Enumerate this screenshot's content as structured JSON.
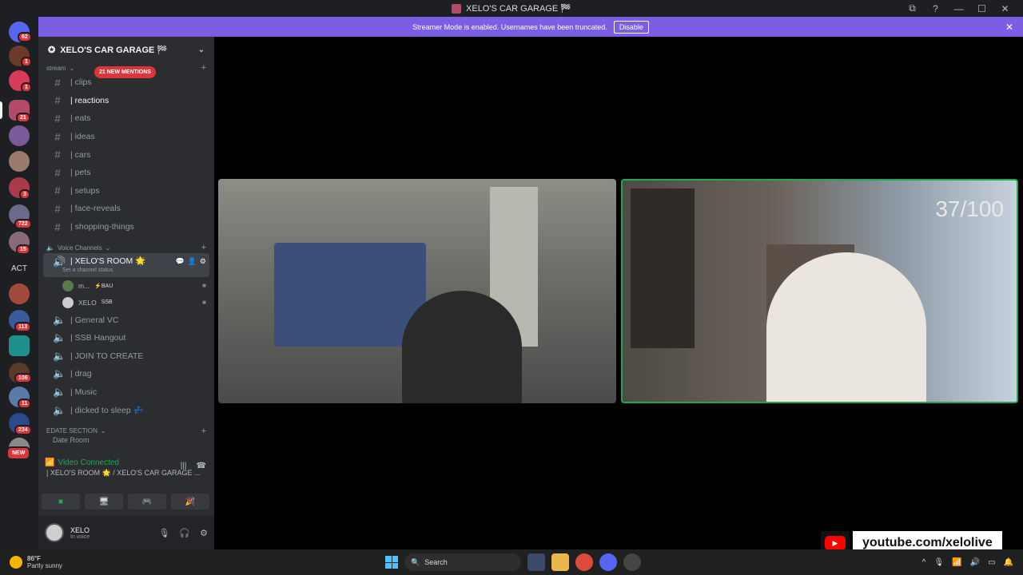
{
  "window": {
    "title": "XELO'S CAR GARAGE 🏁",
    "controls": [
      "⧉",
      "?",
      "—",
      "☐",
      "✕"
    ]
  },
  "banner": {
    "text": "Streamer Mode is enabled. Usernames have been truncated.",
    "button": "Disable"
  },
  "guild_badges": [
    "62",
    "1",
    "1",
    "21",
    "3",
    "722",
    "15",
    "113",
    "106",
    "11",
    "234",
    "NEW"
  ],
  "guild_text": "ACT",
  "server": {
    "name": "XELO'S CAR GARAGE 🏁",
    "mentions": "21 NEW MENTIONS",
    "categories": {
      "stream": "stream",
      "voice": "Voice Channels",
      "edate": "EDATE SECTION"
    },
    "text_channels": [
      "| clips",
      "| reactions",
      "| eats",
      "| ideas",
      "| cars",
      "| pets",
      "| setups",
      "| face-reveals",
      "| shopping-things"
    ],
    "active_voice": {
      "name": "| XELO'S ROOM 🌟",
      "status": "Set a channel status",
      "users": [
        {
          "name": "m...",
          "tag": "⚡BAU"
        },
        {
          "name": "XELO",
          "tag": "SSB"
        }
      ]
    },
    "voice_channels": [
      "| General VC",
      "| SSB Hangout",
      "| JOIN TO CREATE",
      "| drag",
      "| Music",
      "| dicked to sleep 💤"
    ],
    "partial_channel": "Date Room"
  },
  "rtc": {
    "status": "Video Connected",
    "location": "| XELO'S ROOM 🌟 / XELO'S CAR GARAGE ..."
  },
  "user": {
    "name": "XELO",
    "status": "In voice"
  },
  "stream": {
    "counter": "37/100"
  },
  "overlay": {
    "url": "youtube.com/xelolive"
  },
  "taskbar": {
    "temp": "86°F",
    "weather": "Partly sunny",
    "search": "Search"
  }
}
